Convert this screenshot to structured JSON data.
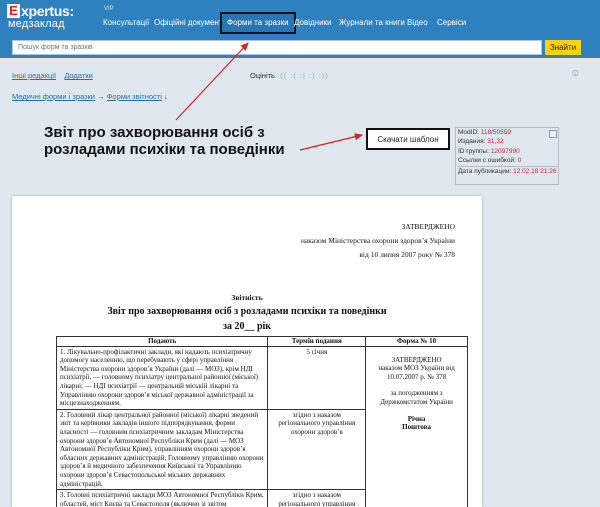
{
  "logo": {
    "main": "xpertus:",
    "letter": "E",
    "sub": "медзаклад",
    "badge": "VIP"
  },
  "nav": [
    {
      "label": "Консультації"
    },
    {
      "label": "Офіційні документи"
    },
    {
      "label": "Форми та зразки",
      "active": true
    },
    {
      "label": "Довідники"
    },
    {
      "label": "Журнали та книги"
    },
    {
      "label": "Відео"
    },
    {
      "label": "Сервіси"
    }
  ],
  "search": {
    "placeholder": "Пошук форм та зразків",
    "button": "Знайти"
  },
  "links": {
    "other_editions": "Інші редакції",
    "attachments": "Додатки"
  },
  "rating": {
    "label": "Оцініть",
    "arrows": ":(( :( :| :) :))"
  },
  "breadcrumb": {
    "item1": "Медичні форми і зразки",
    "arrow": "→",
    "item2": "Форми звітності",
    "tail": "↓"
  },
  "doc_title": "Звіт про захворювання осіб з розладами психіки та поведінки",
  "download_label": "Скачати шаблон",
  "info": {
    "modid_label": "ModID:",
    "modid": "118/50559",
    "edition_label": "Издания:",
    "edition": "31,32",
    "group_label": "ID группы:",
    "group": "12097990",
    "errors_label": "Ссылки с ошибкой:",
    "errors": "0",
    "date_label": "Дата публикации:",
    "date": "12.02.18 21:26"
  },
  "document": {
    "approved": "ЗАТВЕРДЖЕНО",
    "order": "наказом Міністерства охорони здоров’я України",
    "date": "від 10 липня 2007 року № 378",
    "zvitnist": "Звітність",
    "title": "Звіт про захворювання осіб з розладами психіки та поведінки",
    "year": "за 20__ рік",
    "table": {
      "headers": [
        "Подають",
        "Термін подання",
        "Форма № 10"
      ],
      "rows": [
        {
          "who": "1. Лікувально-профілактичні заклади, які надають психіатричну допомогу населенню, що перебувають у сфері управління Міністерства охорони здоров’я України (далі — МОЗ), крім НДІ психіатрії, — головному психіатру центральної районної (міської) лікарні; — НДІ психіатрії — центральній міській лікарні та Управлінню охорони здоров’я міської державної адміністрації за місцезнаходженням.",
          "when": "5 січня"
        },
        {
          "who": "2. Головний лікар центральної районної (міської) лікарні зведений звіт та керівники закладів іншого підпорядкування, форми власності — головним психіатричним закладам Міністерства охорони здоров’я Автономної Республіки Крим (далі — МОЗ Автономної Республіки Крим), управлінням охорони здоров’я обласних державних адміністрацій, Головному управлінню охорони здоров’я й медичного забезпечення Київської та Управлінню охорони здоров’я Севастопольської міських державних адміністрацій.",
          "when": "згідно з наказом регіонального управління охорони здоров’я"
        },
        {
          "who": "3. Головні психіатричні заклади МОЗ Автономної Республіки Крим, областей, міст Києва та Севастополя (включно зі звітом",
          "when": "згідно з наказом регіонального управління охорони"
        }
      ],
      "form_approved": "ЗАТВЕРДЖЕНО",
      "form_order": "наказом МОЗ України від 10.07.2007 р. № 378",
      "form_agreed": "за погодженням з Держкомстатом України",
      "form_period1": "Річна",
      "form_period2": "Поштова"
    }
  }
}
